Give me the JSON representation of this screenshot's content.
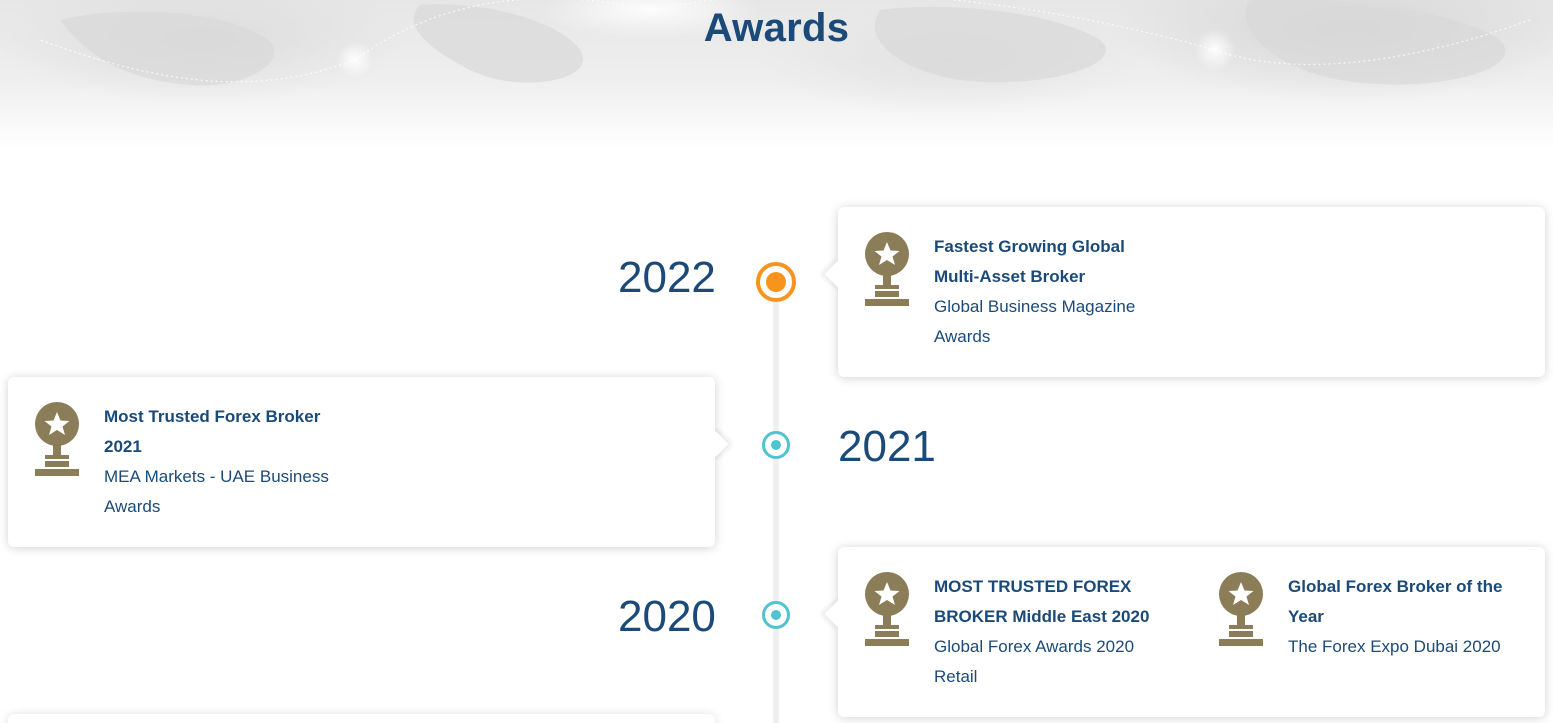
{
  "page": {
    "title": "Awards"
  },
  "timeline": [
    {
      "year": "2022",
      "awards": [
        {
          "name_lines": [
            "Fastest Growing Global",
            "Multi-Asset Broker"
          ],
          "org_lines": [
            "Global Business Magazine",
            "Awards"
          ],
          "icon": "trophy-icon"
        }
      ]
    },
    {
      "year": "2021",
      "awards": [
        {
          "name_lines": [
            "Most Trusted Forex Broker",
            "2021"
          ],
          "org_lines": [
            "MEA Markets - UAE Business",
            "Awards"
          ],
          "icon": "trophy-icon"
        }
      ]
    },
    {
      "year": "2020",
      "awards": [
        {
          "name_lines": [
            "MOST TRUSTED FOREX",
            "BROKER Middle East 2020"
          ],
          "org_lines": [
            "Global Forex Awards 2020",
            "Retail"
          ],
          "icon": "trophy-icon"
        },
        {
          "name_lines": [
            "Global Forex Broker of the",
            "Year"
          ],
          "org_lines": [
            "The Forex Expo Dubai 2020"
          ],
          "icon": "trophy-icon"
        }
      ]
    }
  ],
  "colors": {
    "title": "#1b4a78",
    "trophy": "#8b7d57",
    "dot_active": "#f7941d",
    "dot_inactive": "#4fc3d0"
  }
}
